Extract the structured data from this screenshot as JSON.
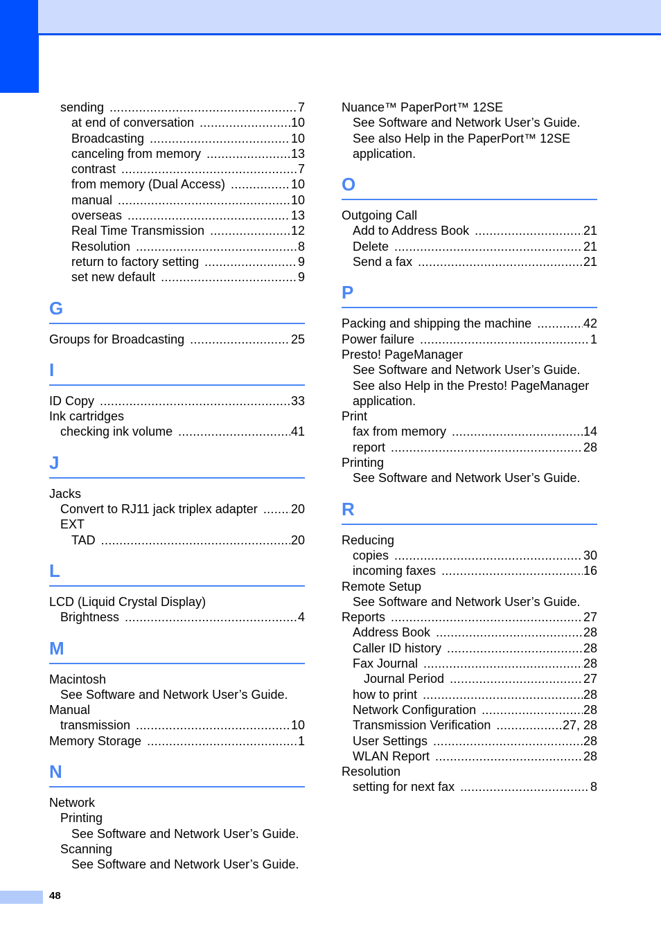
{
  "page_number": "48",
  "colors": {
    "accent": "#0050ff",
    "section_letter": "#4a86f5",
    "band": "#cddcfe",
    "footer_tab": "#b3cbfb"
  },
  "left_column": {
    "continuation": [
      {
        "level": 1,
        "term": "sending",
        "page": "7"
      },
      {
        "level": 2,
        "term": "at end of conversation",
        "page": "10"
      },
      {
        "level": 2,
        "term": "Broadcasting",
        "page": "10"
      },
      {
        "level": 2,
        "term": "canceling from memory",
        "page": "13"
      },
      {
        "level": 2,
        "term": "contrast",
        "page": "7"
      },
      {
        "level": 2,
        "term": "from memory (Dual Access)",
        "page": "10"
      },
      {
        "level": 2,
        "term": "manual",
        "page": "10"
      },
      {
        "level": 2,
        "term": "overseas",
        "page": "13"
      },
      {
        "level": 2,
        "term": "Real Time Transmission",
        "page": "12"
      },
      {
        "level": 2,
        "term": "Resolution",
        "page": "8"
      },
      {
        "level": 2,
        "term": "return to factory setting",
        "page": "9"
      },
      {
        "level": 2,
        "term": "set new default",
        "page": "9"
      }
    ],
    "sections": [
      {
        "letter": "G",
        "entries": [
          {
            "level": 0,
            "term": "Groups for Broadcasting",
            "page": "25"
          }
        ]
      },
      {
        "letter": "I",
        "entries": [
          {
            "level": 0,
            "term": "ID Copy",
            "page": "33"
          },
          {
            "level": 0,
            "term": "Ink cartridges",
            "page": ""
          },
          {
            "level": 1,
            "term": "checking ink volume",
            "page": "41"
          }
        ]
      },
      {
        "letter": "J",
        "entries": [
          {
            "level": 0,
            "term": "Jacks",
            "page": ""
          },
          {
            "level": 1,
            "term": "Convert to RJ11 jack triplex adapter",
            "page": "20"
          },
          {
            "level": 1,
            "term": "EXT",
            "page": ""
          },
          {
            "level": 2,
            "term": "TAD",
            "page": "20"
          }
        ]
      },
      {
        "letter": "L",
        "entries": [
          {
            "level": 0,
            "term": "LCD (Liquid Crystal Display)",
            "page": ""
          },
          {
            "level": 1,
            "term": "Brightness",
            "page": "4"
          }
        ]
      },
      {
        "letter": "M",
        "entries": [
          {
            "level": 0,
            "term": "Macintosh",
            "page": ""
          },
          {
            "level": 1,
            "term": "See Software and Network User’s Guide.",
            "page": ""
          },
          {
            "level": 0,
            "term": "Manual",
            "page": ""
          },
          {
            "level": 1,
            "term": "transmission",
            "page": "10"
          },
          {
            "level": 0,
            "term": "Memory Storage",
            "page": "1"
          }
        ]
      },
      {
        "letter": "N",
        "entries": [
          {
            "level": 0,
            "term": "Network",
            "page": ""
          },
          {
            "level": 1,
            "term": "Printing",
            "page": ""
          },
          {
            "level": 2,
            "term": "See Software and Network User’s Guide.",
            "page": ""
          },
          {
            "level": 1,
            "term": "Scanning",
            "page": ""
          },
          {
            "level": 2,
            "term": "See Software and Network User’s Guide.",
            "page": ""
          }
        ]
      }
    ]
  },
  "right_column": {
    "continuation": [
      {
        "level": 0,
        "term": "Nuance™ PaperPort™ 12SE",
        "page": ""
      },
      {
        "level": 1,
        "term": "See Software and Network User’s Guide.",
        "page": ""
      },
      {
        "level": 1,
        "term": "See also Help in the PaperPort™ 12SE",
        "page": ""
      },
      {
        "level": 1,
        "term": "application.",
        "page": ""
      }
    ],
    "sections": [
      {
        "letter": "O",
        "entries": [
          {
            "level": 0,
            "term": "Outgoing Call",
            "page": ""
          },
          {
            "level": 1,
            "term": "Add to Address Book",
            "page": "21"
          },
          {
            "level": 1,
            "term": "Delete",
            "page": "21"
          },
          {
            "level": 1,
            "term": "Send a fax",
            "page": "21"
          }
        ]
      },
      {
        "letter": "P",
        "entries": [
          {
            "level": 0,
            "term": "Packing and shipping the machine",
            "page": "42"
          },
          {
            "level": 0,
            "term": "Power failure",
            "page": "1"
          },
          {
            "level": 0,
            "term": "Presto! PageManager",
            "page": ""
          },
          {
            "level": 1,
            "term": "See Software and Network User’s Guide.",
            "page": ""
          },
          {
            "level": 1,
            "term": "See also Help in the Presto! PageManager",
            "page": ""
          },
          {
            "level": 1,
            "term": "application.",
            "page": ""
          },
          {
            "level": 0,
            "term": "Print",
            "page": ""
          },
          {
            "level": 1,
            "term": "fax from memory",
            "page": "14"
          },
          {
            "level": 1,
            "term": "report",
            "page": "28"
          },
          {
            "level": 0,
            "term": "Printing",
            "page": ""
          },
          {
            "level": 1,
            "term": "See Software and Network User’s Guide.",
            "page": ""
          }
        ]
      },
      {
        "letter": "R",
        "entries": [
          {
            "level": 0,
            "term": "Reducing",
            "page": ""
          },
          {
            "level": 1,
            "term": "copies",
            "page": "30"
          },
          {
            "level": 1,
            "term": "incoming faxes",
            "page": "16"
          },
          {
            "level": 0,
            "term": "Remote Setup",
            "page": ""
          },
          {
            "level": 1,
            "term": "See Software and Network User’s Guide.",
            "page": ""
          },
          {
            "level": 0,
            "term": "Reports",
            "page": "27"
          },
          {
            "level": 1,
            "term": "Address Book",
            "page": "28"
          },
          {
            "level": 1,
            "term": "Caller ID history",
            "page": "28"
          },
          {
            "level": 1,
            "term": "Fax Journal",
            "page": "28"
          },
          {
            "level": 2,
            "term": "Journal Period",
            "page": "27"
          },
          {
            "level": 1,
            "term": "how to print",
            "page": "28"
          },
          {
            "level": 1,
            "term": "Network Configuration",
            "page": "28"
          },
          {
            "level": 1,
            "term": "Transmission Verification",
            "page": "27, 28"
          },
          {
            "level": 1,
            "term": "User Settings",
            "page": "28"
          },
          {
            "level": 1,
            "term": "WLAN Report",
            "page": "28"
          },
          {
            "level": 0,
            "term": "Resolution",
            "page": ""
          },
          {
            "level": 1,
            "term": "setting for next fax",
            "page": "8"
          }
        ]
      }
    ]
  }
}
